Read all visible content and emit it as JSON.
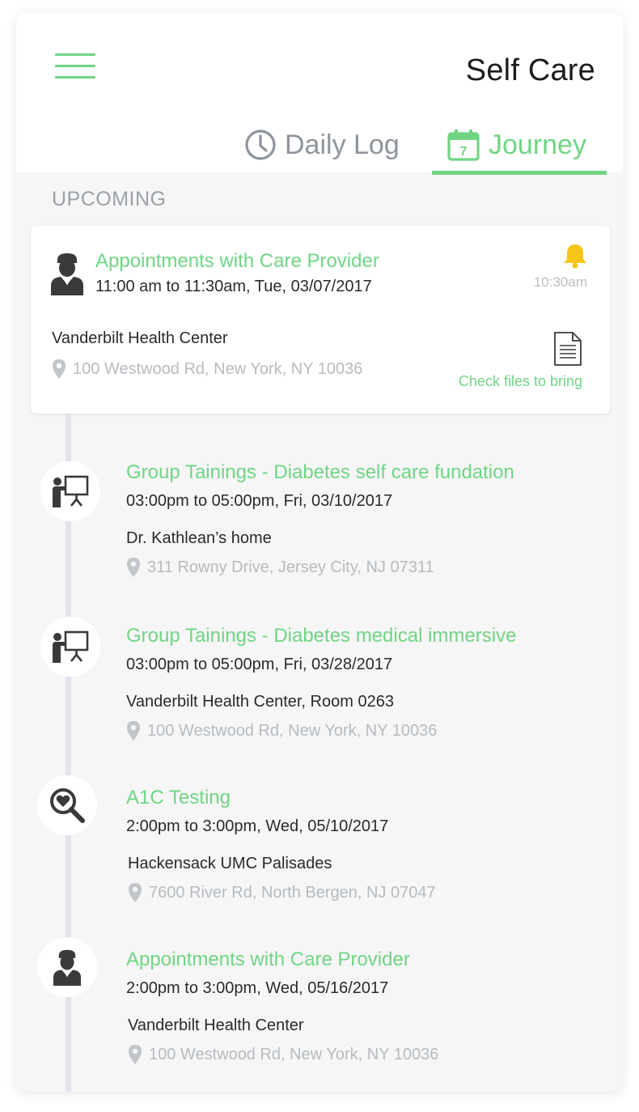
{
  "header": {
    "title": "Self Care",
    "tabs": [
      {
        "label": "Daily Log",
        "icon": "clock-icon",
        "active": false
      },
      {
        "label": "Journey",
        "icon": "calendar-icon",
        "calendar_day": "7",
        "active": true
      }
    ]
  },
  "section_label": "UPCOMING",
  "featured": {
    "icon": "doctor-icon",
    "title": "Appointments with Care Provider",
    "time": "11:00 am to 11:30am, Tue, 03/07/2017",
    "reminder_icon": "bell-icon",
    "reminder_time": "10:30am",
    "place": "Vanderbilt Health Center",
    "address": "100 Westwood Rd, New York, NY 10036",
    "files_icon": "document-icon",
    "files_label": "Check files to bring"
  },
  "events": [
    {
      "icon": "presentation-icon",
      "title": "Group Tainings - Diabetes self care fundation",
      "time": "03:00pm to 05:00pm, Fri, 03/10/2017",
      "place": "Dr. Kathlean’s home",
      "address": "311 Rowny Drive, Jersey City, NJ 07311"
    },
    {
      "icon": "presentation-icon",
      "title": "Group Tainings - Diabetes medical immersive",
      "time": "03:00pm to 05:00pm, Fri, 03/28/2017",
      "place": "Vanderbilt Health Center, Room 0263",
      "address": "100 Westwood Rd, New York, NY 10036"
    },
    {
      "icon": "heart-search-icon",
      "title": "A1C Testing",
      "time": "2:00pm to 3:00pm, Wed, 05/10/2017",
      "place": "Hackensack UMC Palisades",
      "address": "7600 River Rd, North Bergen, NJ 07047"
    },
    {
      "icon": "doctor-icon",
      "title": "Appointments with Care Provider",
      "time": "2:00pm to 3:00pm, Wed, 05/16/2017",
      "place": "Vanderbilt Health Center",
      "address": "100 Westwood Rd, New York, NY 10036"
    }
  ],
  "colors": {
    "accent": "#6fd583",
    "bell": "#f5c518",
    "icon_dark": "#3a3a3a",
    "muted": "#b5bbc0",
    "background": "#f6f6f6"
  }
}
